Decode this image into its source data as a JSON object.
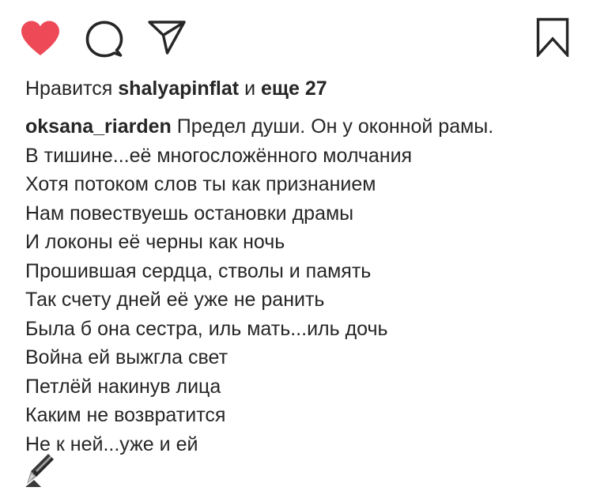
{
  "actions": {
    "like_icon": "heart-filled-icon",
    "comment_icon": "speech-bubble-icon",
    "share_icon": "paper-plane-icon",
    "save_icon": "bookmark-icon",
    "like_color": "#ed4956"
  },
  "likes": {
    "prefix": "Нравится",
    "user": "shalyapinflat",
    "joiner": "и",
    "others": "еще 27"
  },
  "caption": {
    "author": "oksana_riarden",
    "lines": [
      "Предел души. Он у оконной рамы.",
      "В тишине...её многосложённого молчания",
      "Хотя потоком слов ты как признанием",
      "Нам повествуешь остановки драмы",
      "И локоны её черны как ночь",
      "Прошившая сердца, стволы и память",
      "Так счету дней её уже не ранить",
      "Была б она сестра, иль мать...иль дочь",
      "Война ей выжгла свет",
      "Петлёй накинув лица",
      "Каким не возвратится",
      "Не к ней...уже и ей"
    ],
    "emoji": "fountain-pen-emoji"
  }
}
